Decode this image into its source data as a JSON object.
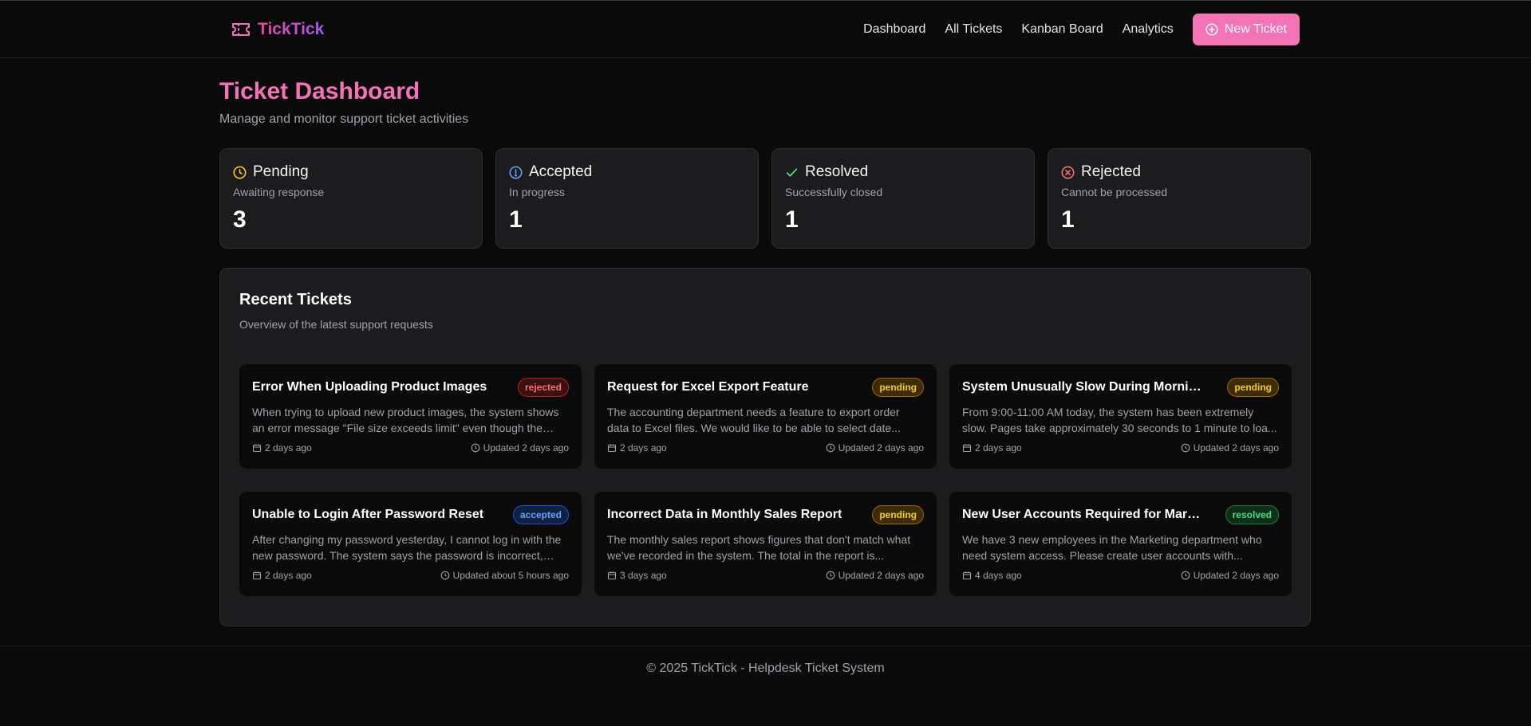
{
  "brand": {
    "name": "TickTick",
    "accent": "#f472b6",
    "accent_2": "#a855f7",
    "icon": "ticket-icon"
  },
  "nav": {
    "items": [
      "Dashboard",
      "All Tickets",
      "Kanban Board",
      "Analytics"
    ],
    "new_ticket": "New Ticket",
    "new_ticket_icon": "plus-circle-icon"
  },
  "page": {
    "title": "Ticket Dashboard",
    "subtitle": "Manage and monitor support ticket activities"
  },
  "stats": [
    {
      "label": "Pending",
      "desc": "Awaiting response",
      "value": "3",
      "icon": "clock-icon",
      "color": "#facc15"
    },
    {
      "label": "Accepted",
      "desc": "In progress",
      "value": "1",
      "icon": "alert-circle-icon",
      "color": "#60a5fa"
    },
    {
      "label": "Resolved",
      "desc": "Successfully closed",
      "value": "1",
      "icon": "check-icon",
      "color": "#4ade80"
    },
    {
      "label": "Rejected",
      "desc": "Cannot be processed",
      "value": "1",
      "icon": "x-circle-icon",
      "color": "#f87171"
    }
  ],
  "recent": {
    "title": "Recent Tickets",
    "subtitle": "Overview of the latest support requests",
    "tickets": [
      {
        "title": "Error When Uploading Product Images",
        "status": "rejected",
        "desc": "When trying to upload new product images, the system shows an error message \"File size exceeds limit\" even though the file...",
        "created": "2 days ago",
        "updated": "Updated 2 days ago"
      },
      {
        "title": "Request for Excel Export Feature",
        "status": "pending",
        "desc": "The accounting department needs a feature to export order data to Excel files. We would like to be able to select date...",
        "created": "2 days ago",
        "updated": "Updated 2 days ago"
      },
      {
        "title": "System Unusually Slow During Morning...",
        "status": "pending",
        "desc": "From 9:00-11:00 AM today, the system has been extremely slow. Pages take approximately 30 seconds to 1 minute to loa...",
        "created": "2 days ago",
        "updated": "Updated 2 days ago"
      },
      {
        "title": "Unable to Login After Password Reset",
        "status": "accepted",
        "desc": "After changing my password yesterday, I cannot log in with the new password. The system says the password is incorrect, eve...",
        "created": "2 days ago",
        "updated": "Updated about 5 hours ago"
      },
      {
        "title": "Incorrect Data in Monthly Sales Report",
        "status": "pending",
        "desc": "The monthly sales report shows figures that don't match what we've recorded in the system. The total in the report is...",
        "created": "3 days ago",
        "updated": "Updated 2 days ago"
      },
      {
        "title": "New User Accounts Required for Marketin...",
        "status": "resolved",
        "desc": "We have 3 new employees in the Marketing department who need system access. Please create user accounts with...",
        "created": "4 days ago",
        "updated": "Updated 2 days ago"
      }
    ]
  },
  "footer": {
    "copyright": "© 2025 TickTick - Helpdesk Ticket System"
  }
}
